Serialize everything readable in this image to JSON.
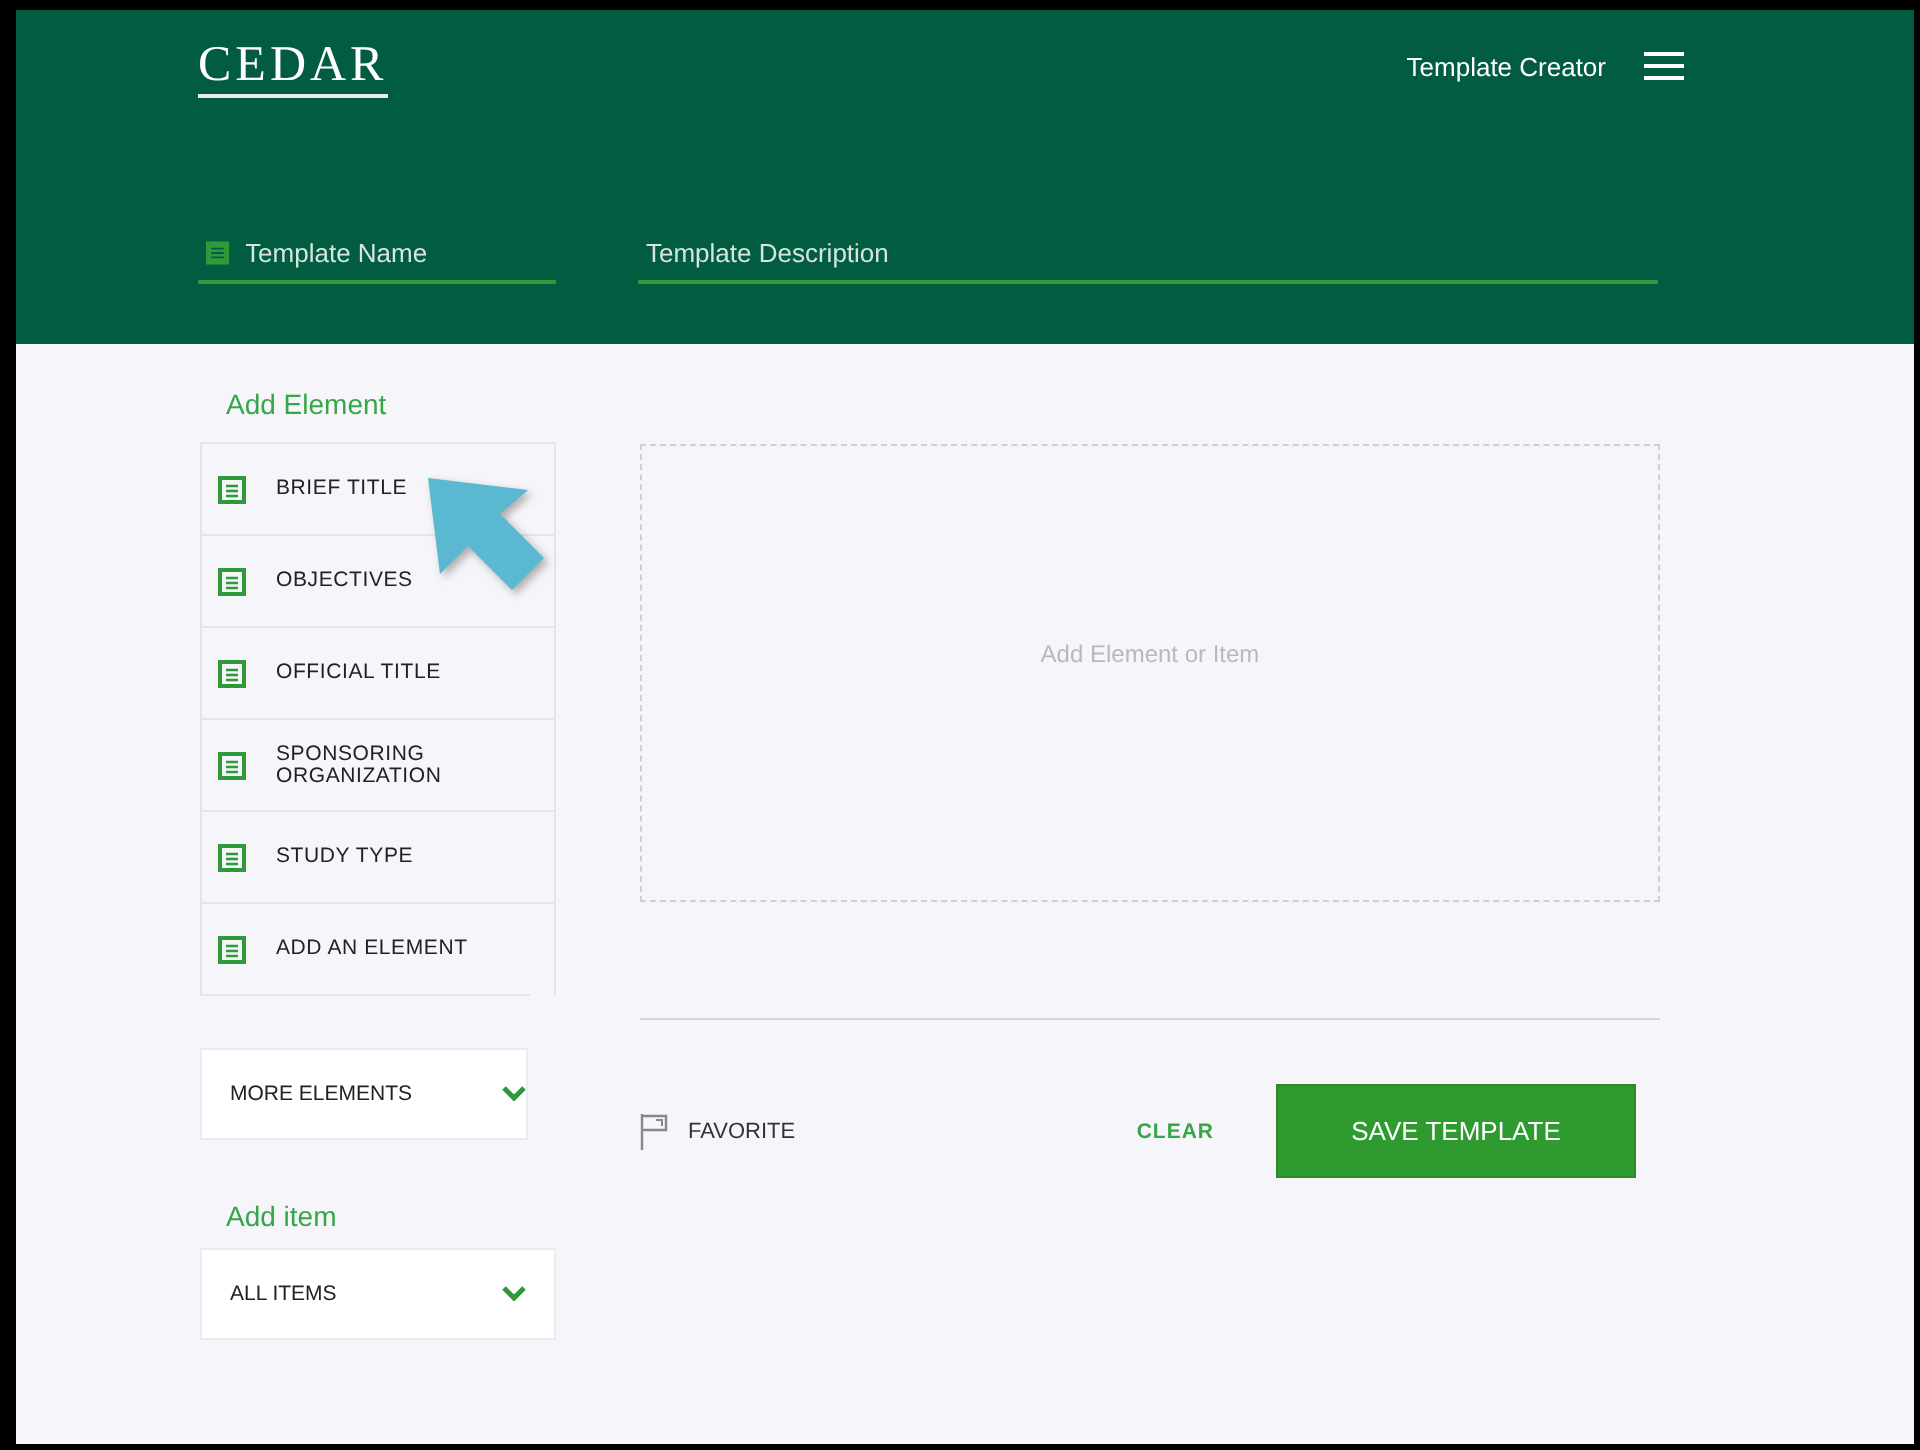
{
  "header": {
    "logo": "CEDAR",
    "nav_title": "Template Creator",
    "name_field": {
      "placeholder": "Template Name"
    },
    "description_field": {
      "placeholder": "Template Description"
    }
  },
  "sidebar": {
    "add_element_heading": "Add Element",
    "elements": [
      {
        "label": "BRIEF TITLE"
      },
      {
        "label": "OBJECTIVES"
      },
      {
        "label": "OFFICIAL TITLE"
      },
      {
        "label": "SPONSORING ORGANIZATION"
      },
      {
        "label": "STUDY TYPE"
      },
      {
        "label": "ADD AN ELEMENT"
      }
    ],
    "more_elements": "MORE ELEMENTS",
    "add_item_heading": "Add item",
    "all_items": "ALL ITEMS"
  },
  "canvas": {
    "placeholder": "Add Element or Item"
  },
  "actions": {
    "favorite": "FAVORITE",
    "clear": "CLEAR",
    "save": "SAVE TEMPLATE"
  }
}
